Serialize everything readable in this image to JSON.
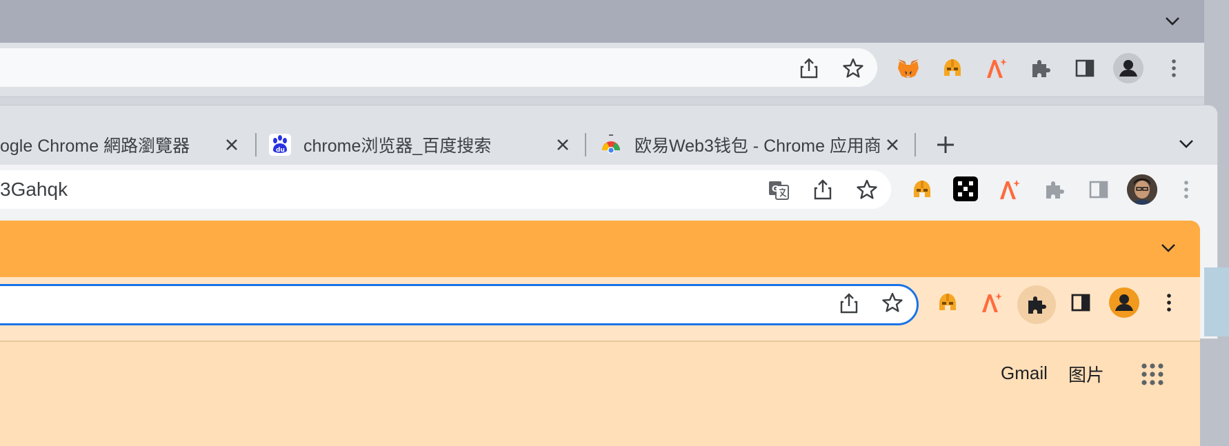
{
  "window_back": {
    "toolbar_icons": [
      "share-icon",
      "star-icon",
      "metamask-icon",
      "helmet-extension-icon",
      "spark-extension-icon",
      "puzzle-icon",
      "side-panel-icon",
      "profile-avatar",
      "kebab-menu-icon"
    ]
  },
  "window_middle": {
    "tabs": [
      {
        "title": "ogle Chrome 網路瀏覽器",
        "favicon": "chrome-favicon"
      },
      {
        "title": "chrome浏览器_百度搜索",
        "favicon": "baidu-favicon"
      },
      {
        "title": "欧易Web3钱包 - Chrome 应用商",
        "favicon": "chrome-webstore-favicon"
      }
    ],
    "new_tab": "+",
    "url": "3Gahqk"
  },
  "window_front": {
    "links": {
      "gmail": "Gmail",
      "images": "图片"
    }
  },
  "colors": {
    "accent_blue": "#1a73e8",
    "front_frame": "#ffac44",
    "front_page": "#ffdfb8"
  }
}
